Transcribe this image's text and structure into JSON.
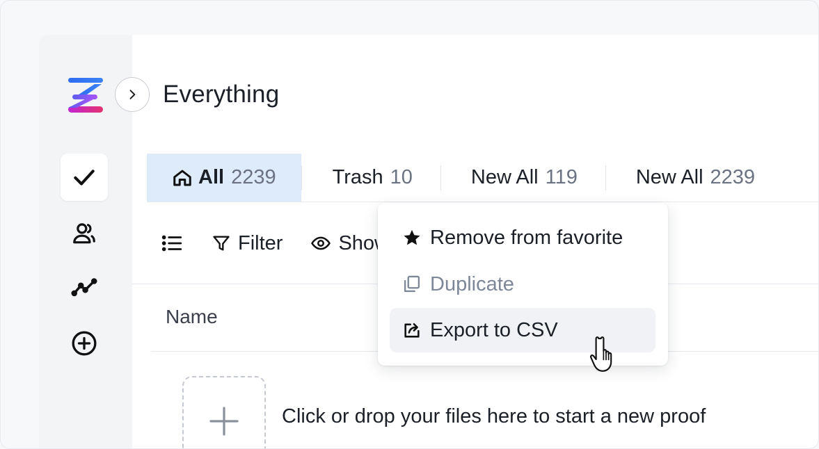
{
  "header": {
    "title": "Everything"
  },
  "tabs": [
    {
      "label": "All",
      "count": "2239",
      "icon": "home-icon",
      "active": true
    },
    {
      "label": "Trash",
      "count": "10"
    },
    {
      "label": "New All",
      "count": "119"
    },
    {
      "label": "New All",
      "count": "2239"
    }
  ],
  "toolbar": {
    "filter_label": "Filter",
    "show_label": "Show"
  },
  "table": {
    "column_name": "Name"
  },
  "dropzone": {
    "text": "Click or drop your files here to start a new proof"
  },
  "context_menu": {
    "items": [
      {
        "label": "Remove from favorite",
        "icon": "star-icon"
      },
      {
        "label": "Duplicate",
        "icon": "copy-icon",
        "disabled": true
      },
      {
        "label": "Export to CSV",
        "icon": "export-icon",
        "hovered": true
      }
    ]
  },
  "colors": {
    "active_tab_bg": "#deebfb",
    "sidebar_bg": "#f3f4f6",
    "logo_blue": "#2d6cf2",
    "logo_purple": "#8b45e6",
    "logo_pink": "#e5336f"
  }
}
